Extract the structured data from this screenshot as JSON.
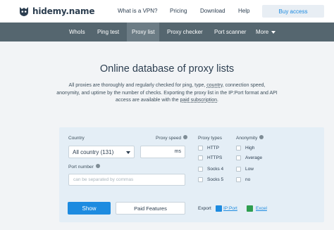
{
  "header": {
    "logo_text": "hidemy.name",
    "nav": [
      "What is a VPN?",
      "Pricing",
      "Download",
      "Help"
    ],
    "buy_label": "Buy access"
  },
  "subnav": {
    "items": [
      "WhoIs",
      "Ping test",
      "Proxy list",
      "Proxy checker",
      "Port scanner",
      "More"
    ],
    "active": "Proxy list"
  },
  "main": {
    "title": "Online database of proxy lists",
    "desc_1": "All proxies are thoroughly and regularly checked for ping, type, ",
    "desc_country": "country",
    "desc_2": ", connection speed, anonymity, and uptime by the number of checks. Exporting the proxy list in the IP:Port format and API access are available with the ",
    "desc_paid": "paid subscription",
    "desc_3": "."
  },
  "filters": {
    "country_label": "Country",
    "country_value": "All country (131)",
    "speed_label": "Proxy speed",
    "speed_unit": "ms",
    "port_label": "Port number",
    "port_placeholder": "can be separated by commas",
    "types_label": "Proxy types",
    "types": [
      "HTTP",
      "HTTPS",
      "Socks 4",
      "Socks 5"
    ],
    "anon_label": "Anonymity",
    "anonymity": [
      "High",
      "Average",
      "Low",
      "no"
    ],
    "show_label": "Show",
    "paid_label": "Paid Features",
    "export_label": "Export",
    "export_ipport": "IP:Port",
    "export_excel": "Excel"
  },
  "colors": {
    "accent": "#1d8be0",
    "subnav_bg": "#55666f",
    "panel_bg": "#e4eef6"
  }
}
